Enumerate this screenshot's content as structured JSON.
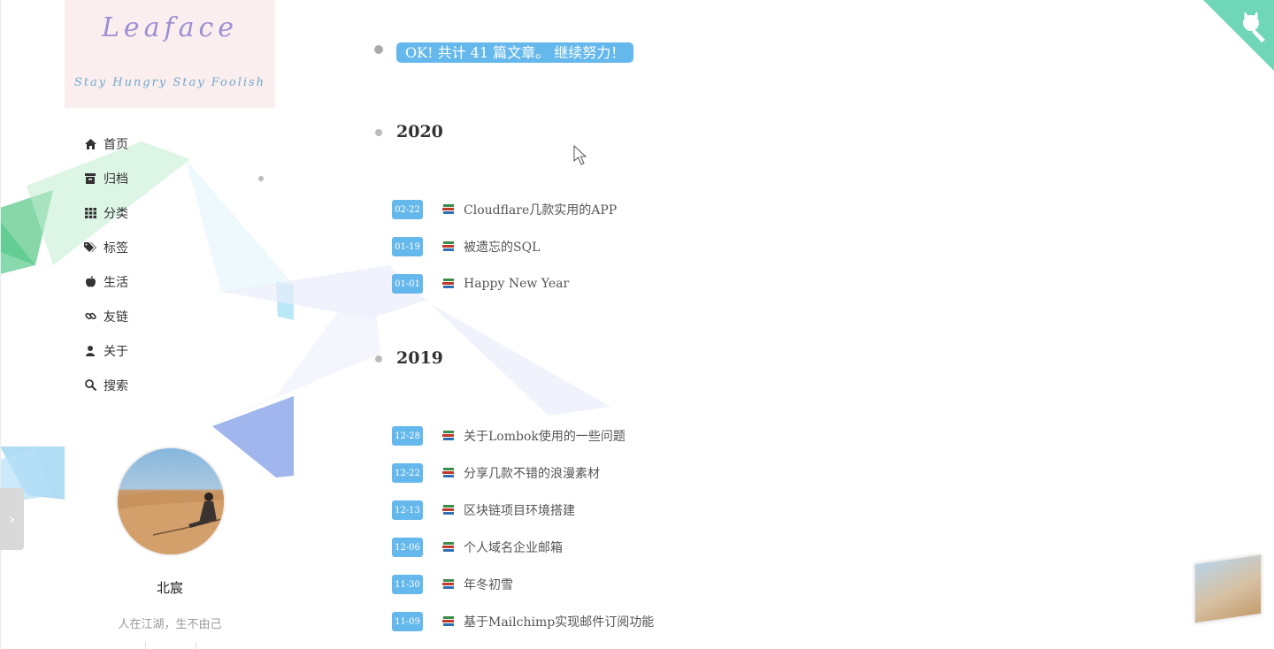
{
  "brand": {
    "title": "Leaface",
    "subtitle": "Stay Hungry Stay Foolish"
  },
  "menu": [
    {
      "label": "首页",
      "icon": "home-icon"
    },
    {
      "label": "归档",
      "icon": "archive-icon"
    },
    {
      "label": "分类",
      "icon": "grid-icon"
    },
    {
      "label": "标签",
      "icon": "tags-icon"
    },
    {
      "label": "生活",
      "icon": "apple-icon"
    },
    {
      "label": "友链",
      "icon": "link-icon"
    },
    {
      "label": "关于",
      "icon": "user-icon"
    },
    {
      "label": "搜索",
      "icon": "search-icon"
    }
  ],
  "profile": {
    "name": "北宸",
    "motto": "人在江湖，生不由己"
  },
  "archive": {
    "summary": "OK! 共计 41 篇文章。 继续努力！",
    "years": [
      {
        "year": "2020",
        "posts": [
          {
            "date": "02-22",
            "title": "Cloudflare几款实用的APP"
          },
          {
            "date": "01-19",
            "title": "被遗忘的SQL"
          },
          {
            "date": "01-01",
            "title": "Happy New Year"
          }
        ]
      },
      {
        "year": "2019",
        "posts": [
          {
            "date": "12-28",
            "title": "关于Lombok使用的一些问题"
          },
          {
            "date": "12-22",
            "title": "分享几款不错的浪漫素材"
          },
          {
            "date": "12-13",
            "title": "区块链项目环境搭建"
          },
          {
            "date": "12-06",
            "title": "个人域名企业邮箱"
          },
          {
            "date": "11-30",
            "title": "年冬初雪"
          },
          {
            "date": "11-09",
            "title": "基于Mailchimp实现邮件订阅功能"
          }
        ]
      }
    ]
  },
  "colors": {
    "accent": "#65b8ec",
    "brand_bg": "#fbeeee",
    "github_corner": "#6fd6b8"
  },
  "toggle": {
    "label": "›"
  }
}
